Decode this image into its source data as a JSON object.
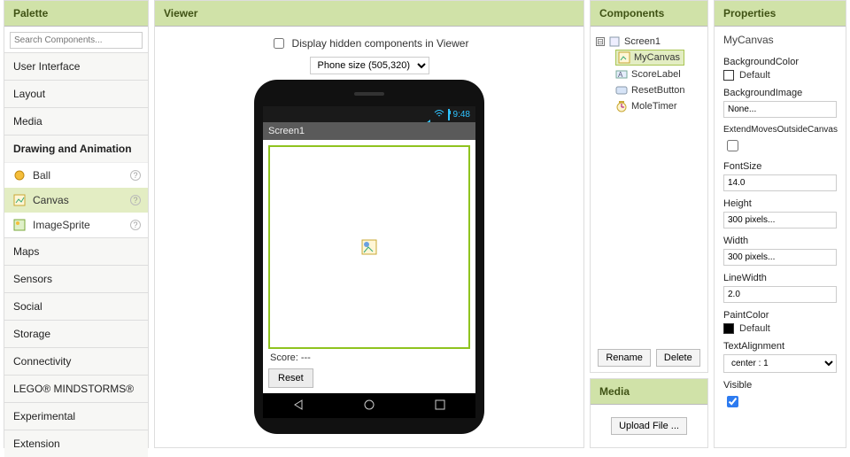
{
  "palette": {
    "title": "Palette",
    "search_placeholder": "Search Components...",
    "categories": [
      "User Interface",
      "Layout",
      "Media",
      "Drawing and Animation",
      "Maps",
      "Sensors",
      "Social",
      "Storage",
      "Connectivity",
      "LEGO® MINDSTORMS®",
      "Experimental",
      "Extension"
    ],
    "open_category_index": 3,
    "items": [
      {
        "label": "Ball",
        "icon": "ball-icon"
      },
      {
        "label": "Canvas",
        "icon": "canvas-icon",
        "selected": true
      },
      {
        "label": "ImageSprite",
        "icon": "imagesprite-icon"
      }
    ],
    "help_glyph": "?"
  },
  "viewer": {
    "title": "Viewer",
    "display_hidden_label": "Display hidden components in Viewer",
    "display_hidden_checked": false,
    "size_selected": "Phone size (505,320)",
    "statusbar_time": "9:48",
    "screen_title": "Screen1",
    "score_label": "Score: ---",
    "reset_label": "Reset"
  },
  "components": {
    "title": "Components",
    "tree": {
      "root": "Screen1",
      "children": [
        {
          "label": "MyCanvas",
          "icon": "canvas-icon",
          "selected": true
        },
        {
          "label": "ScoreLabel",
          "icon": "label-icon"
        },
        {
          "label": "ResetButton",
          "icon": "button-icon"
        },
        {
          "label": "MoleTimer",
          "icon": "clock-icon"
        }
      ]
    },
    "rename_label": "Rename",
    "delete_label": "Delete",
    "toggle_glyph": "⊟"
  },
  "media": {
    "title": "Media",
    "upload_label": "Upload File ..."
  },
  "properties": {
    "title": "Properties",
    "component_name": "MyCanvas",
    "fields": {
      "BackgroundColor": {
        "label": "BackgroundColor",
        "value": "Default",
        "swatch": "white"
      },
      "BackgroundImage": {
        "label": "BackgroundImage",
        "value": "None..."
      },
      "ExtendMovesOutsideCanvas": {
        "label": "ExtendMovesOutsideCanvas",
        "checked": false
      },
      "FontSize": {
        "label": "FontSize",
        "value": "14.0"
      },
      "Height": {
        "label": "Height",
        "value": "300 pixels..."
      },
      "Width": {
        "label": "Width",
        "value": "300 pixels..."
      },
      "LineWidth": {
        "label": "LineWidth",
        "value": "2.0"
      },
      "PaintColor": {
        "label": "PaintColor",
        "value": "Default",
        "swatch": "black"
      },
      "TextAlignment": {
        "label": "TextAlignment",
        "value": "center : 1"
      },
      "Visible": {
        "label": "Visible",
        "checked": true
      }
    }
  }
}
